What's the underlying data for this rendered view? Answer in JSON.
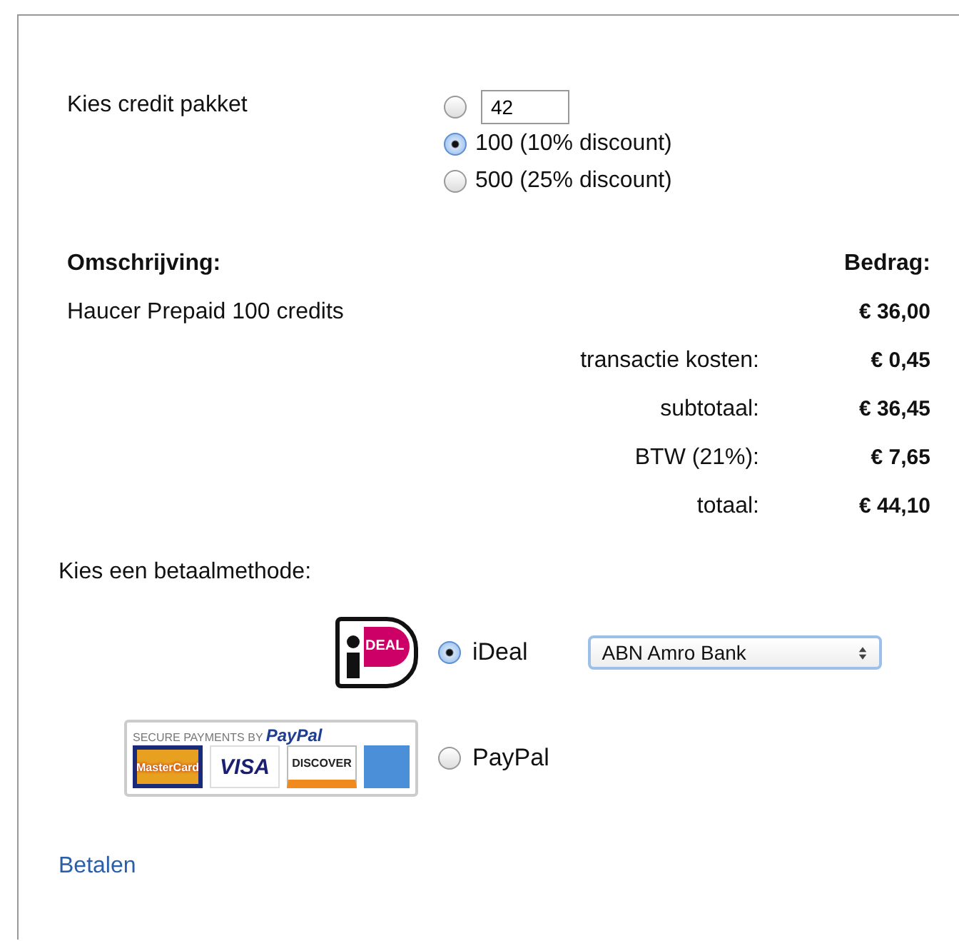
{
  "package": {
    "label": "Kies credit pakket",
    "custom_value": "42",
    "options": [
      {
        "kind": "custom",
        "selected": false
      },
      {
        "kind": "text",
        "label": "100 (10% discount)",
        "selected": true
      },
      {
        "kind": "text",
        "label": "500 (25% discount)",
        "selected": false
      }
    ]
  },
  "summary": {
    "description_heading": "Omschrijving:",
    "amount_heading": "Bedrag:",
    "item": {
      "name": "Haucer Prepaid 100 credits",
      "amount": "€ 36,00"
    },
    "totals": [
      {
        "label": "transactie kosten:",
        "amount": "€ 0,45"
      },
      {
        "label": "subtotaal:",
        "amount": "€ 36,45"
      },
      {
        "label": "BTW (21%):",
        "amount": "€ 7,65"
      },
      {
        "label": "totaal:",
        "amount": "€ 44,10"
      }
    ]
  },
  "payment": {
    "label": "Kies een betaalmethode:",
    "methods": [
      {
        "kind": "ideal",
        "logo_text": "DEAL",
        "label": "iDeal",
        "selected": true,
        "bank": "ABN Amro Bank"
      },
      {
        "kind": "paypal",
        "badge_caption": "SECURE PAYMENTS BY",
        "badge_brand": "PayPal",
        "cards": [
          "MasterCard",
          "VISA",
          "DISCOVER"
        ],
        "label": "PayPal",
        "selected": false
      }
    ]
  },
  "submit": "Betalen"
}
